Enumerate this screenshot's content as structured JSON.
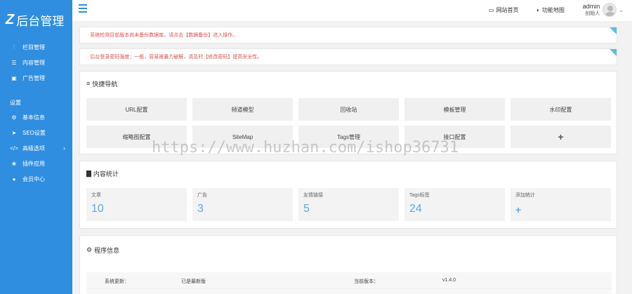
{
  "app": {
    "logo_mark": "Z",
    "logo_text": "后台管理"
  },
  "sidebar": {
    "items": [
      {
        "label": "栏目管理",
        "icon": "sitemap-icon"
      },
      {
        "label": "内容管理",
        "icon": "list-icon"
      },
      {
        "label": "广告管理",
        "icon": "image-icon"
      }
    ],
    "section_label": "设置",
    "settings_items": [
      {
        "label": "基本信息",
        "icon": "gear-icon"
      },
      {
        "label": "SEO设置",
        "icon": "send-icon"
      },
      {
        "label": "高级选项",
        "icon": "code-icon"
      },
      {
        "label": "插件应用",
        "icon": "puzzle-icon"
      },
      {
        "label": "会员中心",
        "icon": "user-icon"
      }
    ]
  },
  "header": {
    "home_link": "网站首页",
    "clear_link": "功能地图",
    "username": "admin",
    "role": "创始人"
  },
  "notices": [
    "· 系统检测目前版本尚未备份数据库，请点击【数据备份】进入操作。",
    "· 后台登录密码强度：一般，容易被暴力破解，请及时【修改密码】提高安全性。"
  ],
  "quick_nav": {
    "title": "快捷导航",
    "items": [
      "URL配置",
      "频道模型",
      "回收站",
      "模板管理",
      "水印配置",
      "缩略图配置",
      "SiteMap",
      "Tags管理",
      "接口配置",
      "+"
    ]
  },
  "stats": {
    "title": "内容统计",
    "items": [
      {
        "label": "文章",
        "value": "10"
      },
      {
        "label": "广告",
        "value": "3"
      },
      {
        "label": "友情链接",
        "value": "5"
      },
      {
        "label": "Tags标签",
        "value": "24"
      },
      {
        "label": "添加统计",
        "value": "+"
      }
    ]
  },
  "program_info": {
    "title": "程序信息",
    "rows": [
      {
        "k1": "系统更新：",
        "v1": "已是最新版",
        "k2": "当前版本：",
        "v2": "v1.4.0"
      }
    ]
  },
  "watermark": "https://www.huzhan.com/ishop36731"
}
